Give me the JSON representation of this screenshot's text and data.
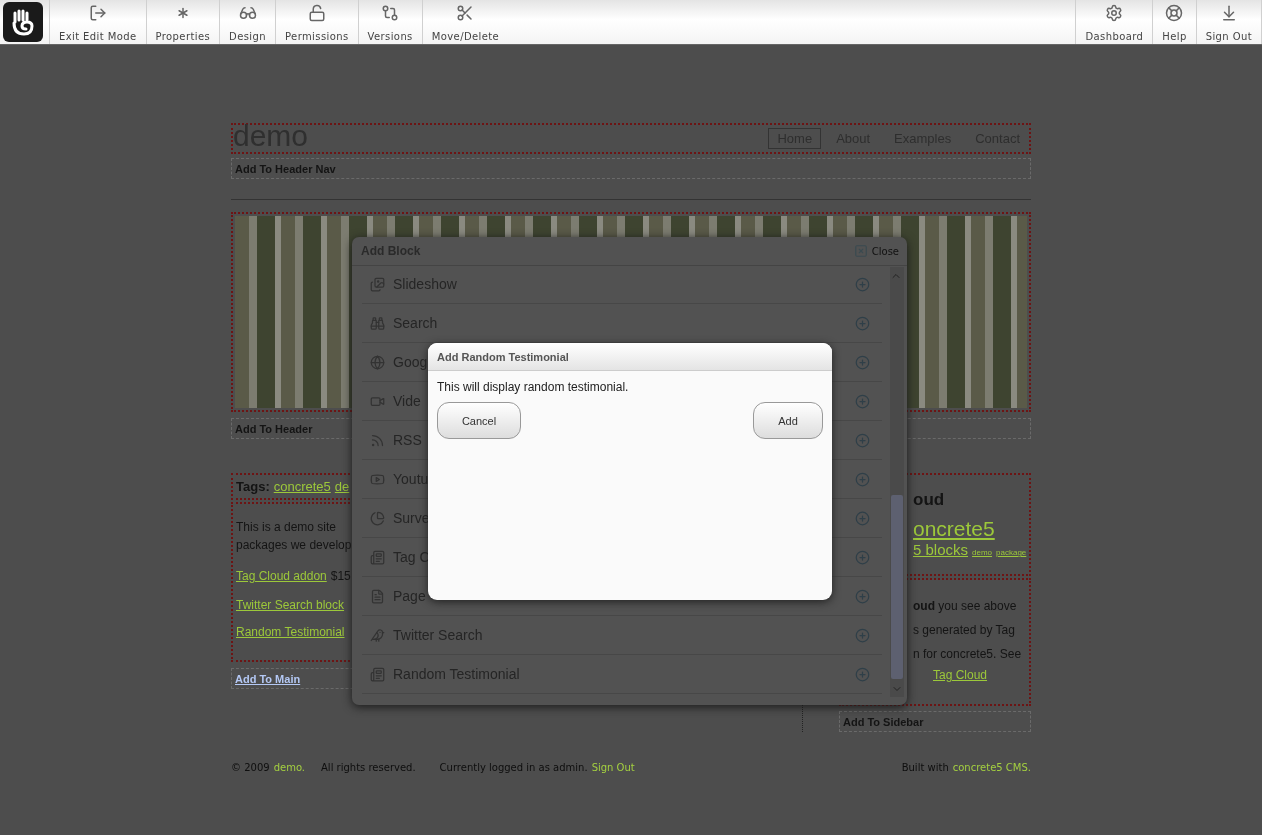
{
  "toolbar": {
    "left": [
      {
        "label": "Exit Edit Mode"
      },
      {
        "label": "Properties"
      },
      {
        "label": "Design"
      },
      {
        "label": "Permissions"
      },
      {
        "label": "Versions"
      },
      {
        "label": "Move/Delete"
      }
    ],
    "right": [
      {
        "label": "Dashboard"
      },
      {
        "label": "Help"
      },
      {
        "label": "Sign Out"
      }
    ]
  },
  "header": {
    "title": "demo",
    "nav": [
      {
        "label": "Home",
        "selected": true
      },
      {
        "label": "About",
        "selected": false
      },
      {
        "label": "Examples",
        "selected": false
      },
      {
        "label": "Contact",
        "selected": false
      }
    ],
    "add_area": "Add To Header Nav"
  },
  "banner": {
    "add_area": "Add To Header"
  },
  "main": {
    "tags_label": "Tags:",
    "tags": [
      "concrete5",
      "de"
    ],
    "paragraph_lines": [
      "This is a demo site",
      "packages we develop"
    ],
    "links": [
      {
        "link": "Tag Cloud addon",
        "after": "$15"
      },
      {
        "link": "Twitter Search block"
      },
      {
        "link": "Random Testimonial"
      }
    ],
    "add_area": "Add To Main"
  },
  "sidebar": {
    "heading": "oud",
    "cloud_big": "oncrete5",
    "cloud_mid": "5 blocks",
    "cloud_small": [
      "demo",
      "package"
    ],
    "lines": [
      "**oud** you see above",
      "s generated by Tag",
      "n for concrete5. See"
    ],
    "link": "Tag Cloud",
    "add_area": "Add To Sidebar"
  },
  "footer": {
    "copyright": "© 2009",
    "site": "demo.",
    "rights": "All rights reserved.",
    "logged": "Currently logged in as admin.",
    "signout": "Sign Out",
    "built": "Built with",
    "cms": "concrete5 CMS."
  },
  "add_block": {
    "title": "Add Block",
    "close": "Close",
    "blocks": [
      "Slideshow",
      "Search",
      "Goog",
      "Vide",
      "RSS",
      "Youtu",
      "Surve",
      "Tag C",
      "Page",
      "Twitter Search",
      "Random Testimonial"
    ]
  },
  "testimonial_dialog": {
    "title": "Add Random Testimonial",
    "text": "This will display random testimonial.",
    "cancel": "Cancel",
    "add": "Add"
  }
}
